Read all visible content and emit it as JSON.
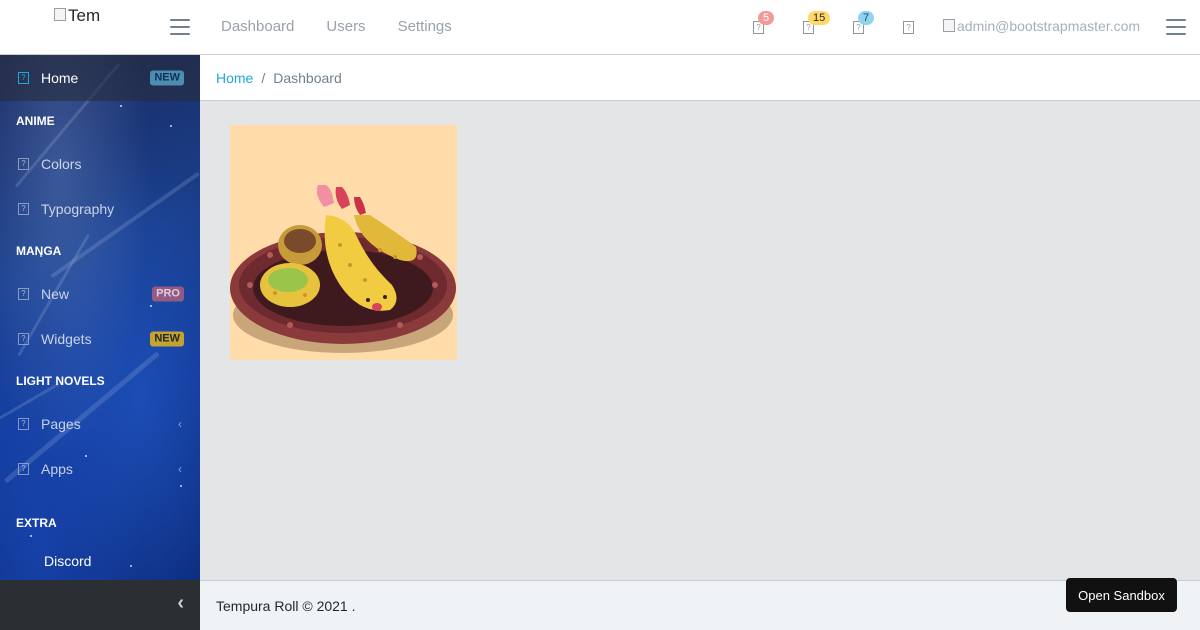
{
  "brand": {
    "logo_alt": "Tem"
  },
  "header": {
    "nav": [
      "Dashboard",
      "Users",
      "Settings"
    ],
    "notifications": [
      {
        "icon": "bell-icon",
        "count": "5",
        "color": "#f29a99"
      },
      {
        "icon": "list-icon",
        "count": "15",
        "color": "#ffd866"
      },
      {
        "icon": "envelope-icon",
        "count": "7",
        "color": "#8fd3ee"
      },
      {
        "icon": "location-icon",
        "count": ""
      }
    ],
    "user_email": "admin@bootstrapmaster.com"
  },
  "sidebar": {
    "home": {
      "label": "Home",
      "badge": "NEW"
    },
    "sections": [
      {
        "title": "ANIME",
        "items": [
          {
            "label": "Colors"
          },
          {
            "label": "Typography"
          }
        ]
      },
      {
        "title": "MANGA",
        "items": [
          {
            "label": "New",
            "badge": "PRO"
          },
          {
            "label": "Widgets",
            "badge": "NEW"
          }
        ]
      },
      {
        "title": "LIGHT NOVELS",
        "items": [
          {
            "label": "Pages"
          },
          {
            "label": "Apps"
          }
        ]
      },
      {
        "title": "EXTRA",
        "items": [
          {
            "label": "Discord"
          }
        ]
      }
    ]
  },
  "breadcrumb": {
    "home": "Home",
    "separator": "/",
    "current": "Dashboard"
  },
  "footer": {
    "text": "Tempura Roll © 2021 ."
  },
  "sandbox": {
    "label": "Open Sandbox"
  },
  "colors": {
    "accent": "#20a8d8",
    "sidebar": "#1a3f8c",
    "image_bg": "#ffdcaa"
  }
}
